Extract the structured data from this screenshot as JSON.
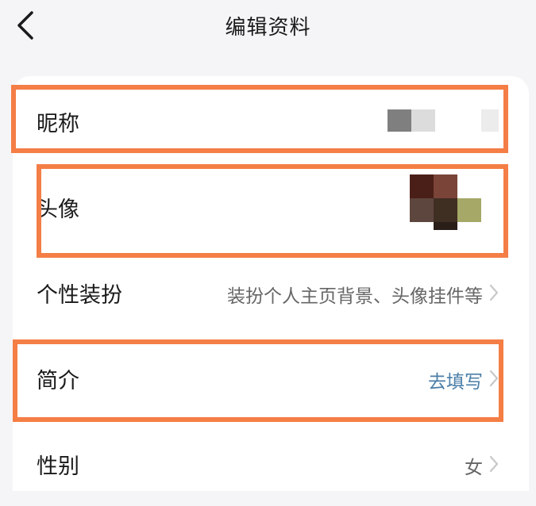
{
  "header": {
    "title": "编辑资料",
    "back_icon": "chevron-left-icon"
  },
  "rows": [
    {
      "label": "昵称",
      "value": "",
      "type": "nickname"
    },
    {
      "label": "头像",
      "value": "",
      "type": "avatar"
    },
    {
      "label": "个性装扮",
      "value": "装扮个人主页背景、头像挂件等",
      "type": "text"
    },
    {
      "label": "简介",
      "value": "去填写",
      "type": "link"
    },
    {
      "label": "性别",
      "value": "女",
      "type": "text"
    }
  ],
  "colors": {
    "highlight": "#f47e45",
    "link": "#4a7ea8",
    "background": "#f5f5f7"
  }
}
